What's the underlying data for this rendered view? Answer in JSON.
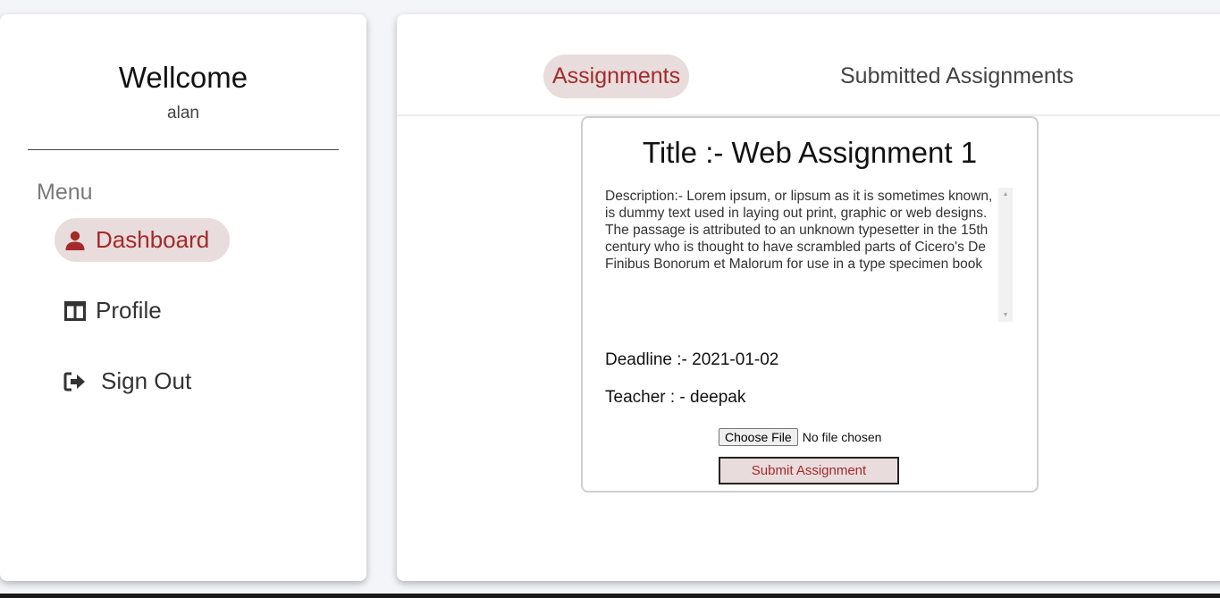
{
  "sidebar": {
    "welcome": "Wellcome",
    "username": "alan",
    "menu_label": "Menu",
    "items": [
      {
        "label": "Dashboard",
        "icon": "user-icon",
        "active": true
      },
      {
        "label": "Profile",
        "icon": "columns-icon",
        "active": false
      },
      {
        "label": "Sign Out",
        "icon": "sign-out-icon",
        "active": false
      }
    ]
  },
  "tabs": [
    {
      "label": "Assignments",
      "active": true
    },
    {
      "label": "Submitted Assignments",
      "active": false
    }
  ],
  "assignment": {
    "title": "Title :- Web Assignment 1",
    "description": "Description:- Lorem ipsum, or lipsum as it is sometimes known, is dummy text used in laying out print, graphic or web designs. The passage is attributed to an unknown typesetter in the 15th century who is thought to have scrambled parts of Cicero's De Finibus Bonorum et Malorum for use in a type specimen book",
    "deadline": "Deadline :- 2021-01-02",
    "teacher": "Teacher : - deepak",
    "choose_file_label": "Choose File",
    "file_status": "No file chosen",
    "submit_label": "Submit Assignment"
  },
  "colors": {
    "accent": "#a52a2a",
    "accent_bg": "#e8dcdc",
    "page_bg": "#f4f5f9"
  }
}
